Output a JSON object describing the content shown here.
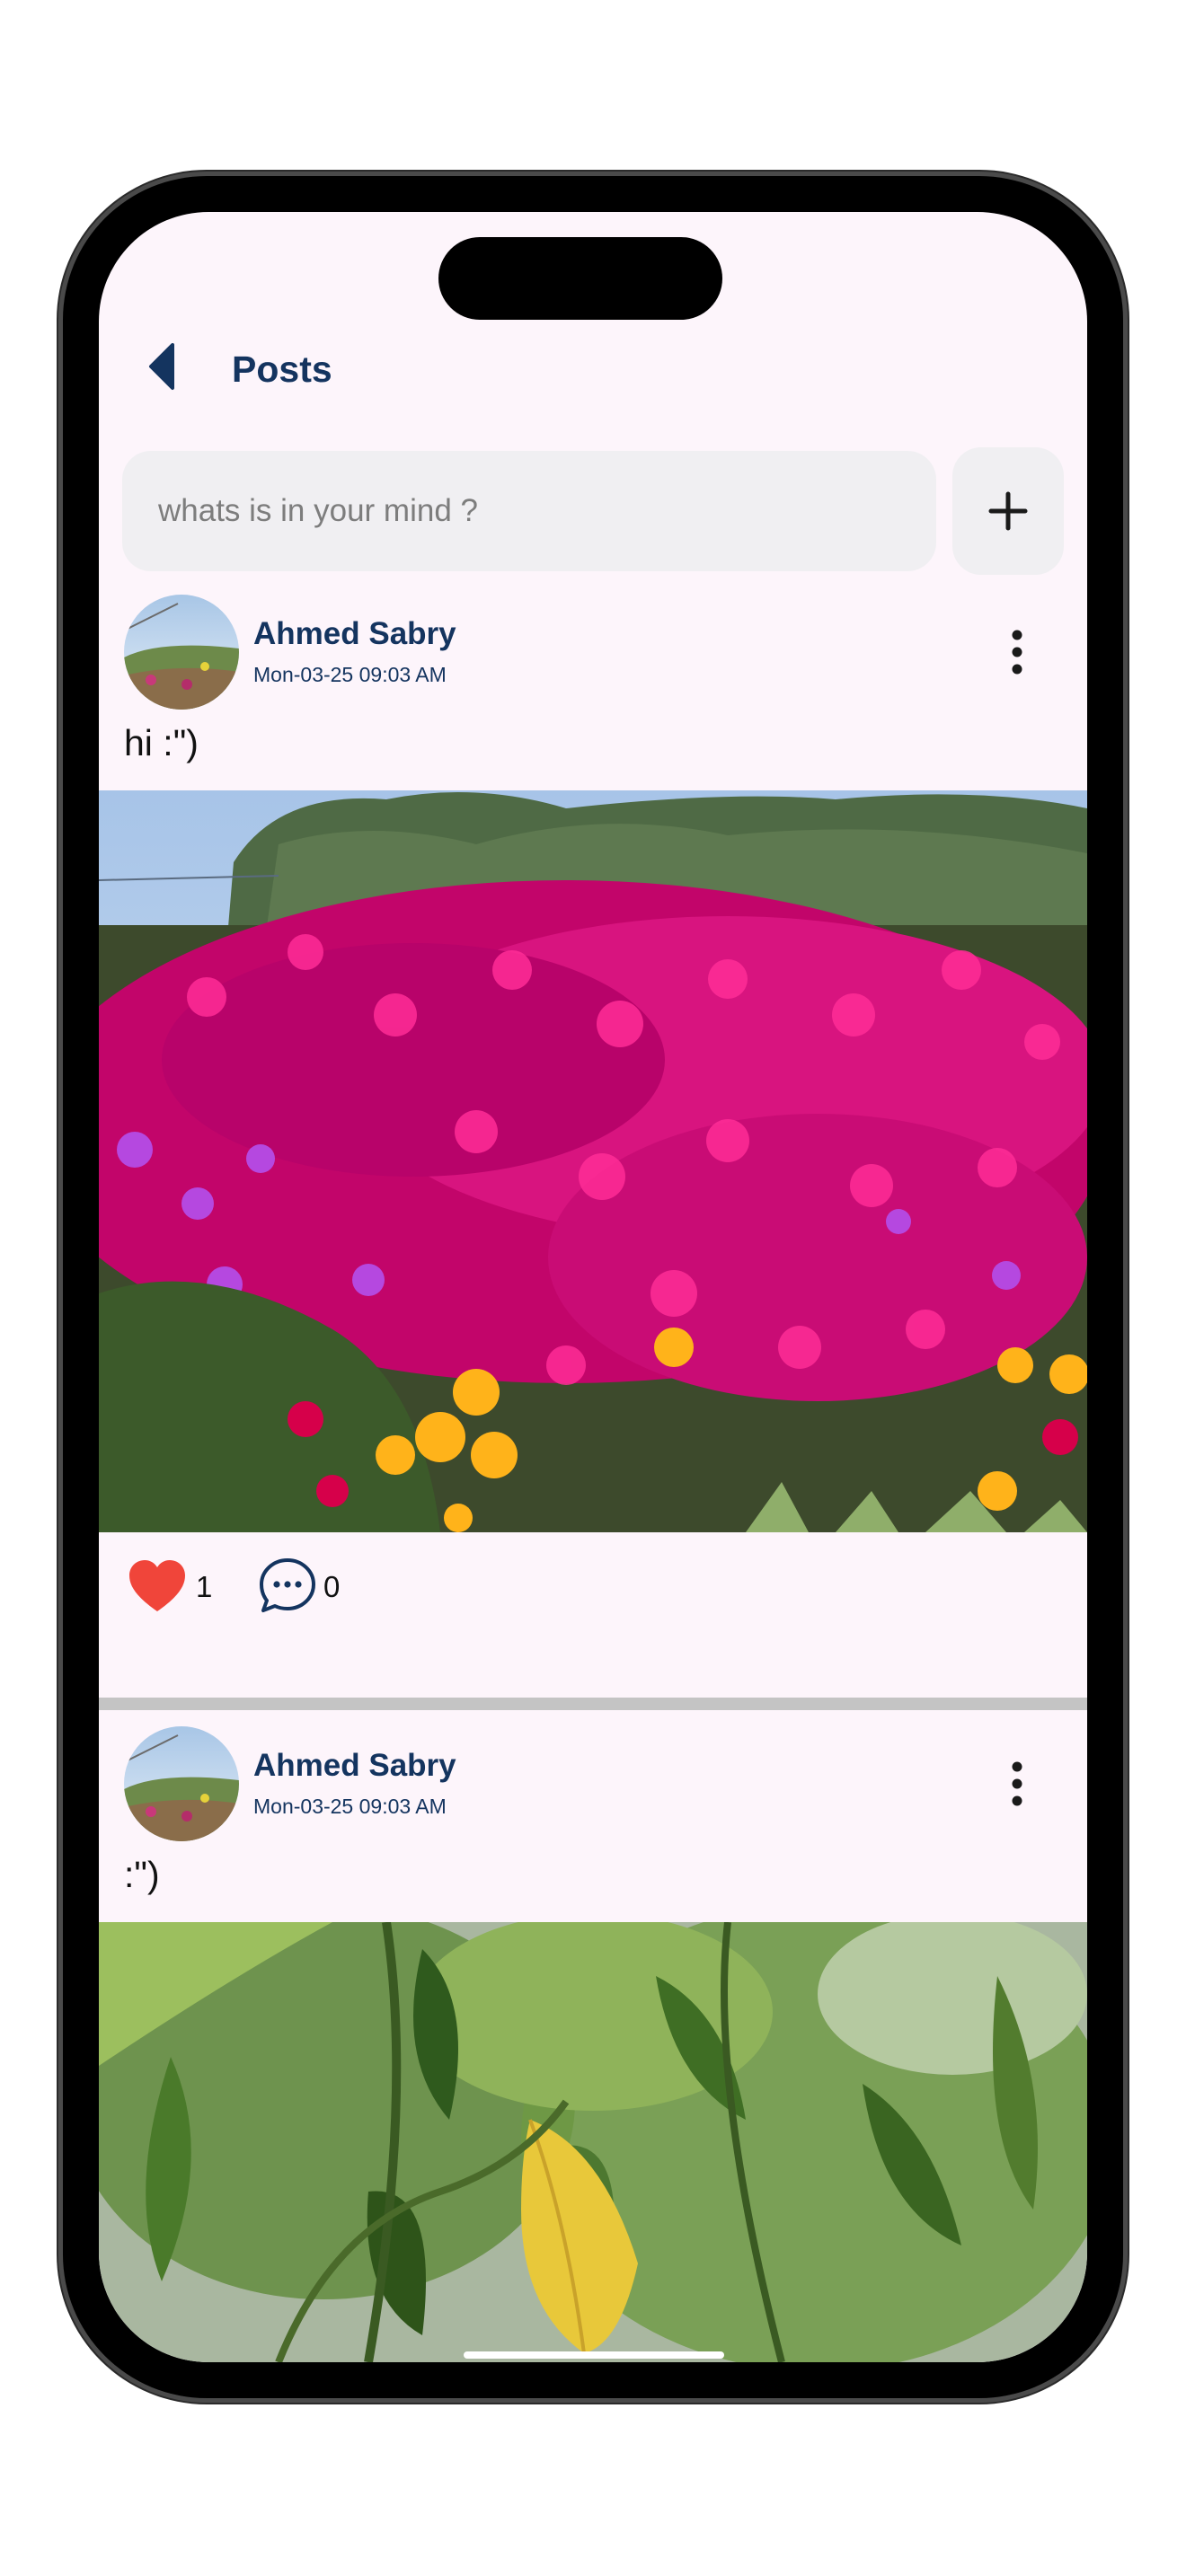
{
  "appbar": {
    "title": "Posts",
    "back_icon": "back-arrow-icon"
  },
  "composer": {
    "placeholder": "whats is in your mind ?",
    "add_icon": "plus-icon"
  },
  "posts": [
    {
      "author": "Ahmed Sabry",
      "timestamp": "Mon-03-25 09:03 AM",
      "text": "hi :\")",
      "likes": "1",
      "comments": "0",
      "image_subject": "magenta ice plant flower field"
    },
    {
      "author": "Ahmed Sabry",
      "timestamp": "Mon-03-25 09:03 AM",
      "text": ":\")",
      "image_subject": "green citrus leaves"
    }
  ],
  "colors": {
    "accent": "#14345f",
    "background": "#fdf5fb",
    "like": "#f0453a",
    "input_bg": "#f0eff2",
    "divider": "#c4c4c4"
  }
}
